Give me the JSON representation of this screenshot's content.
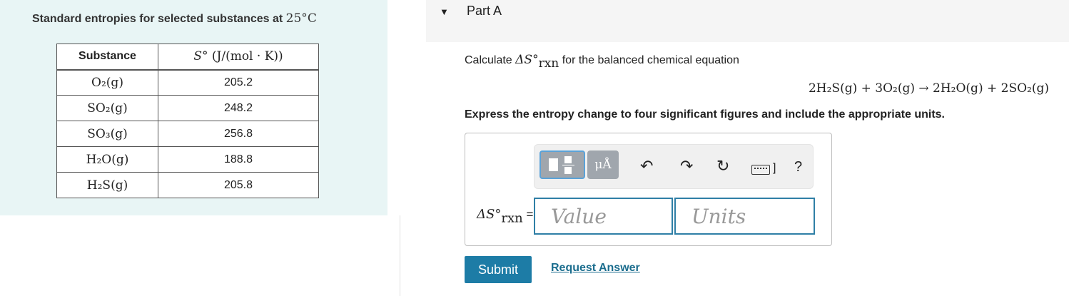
{
  "left_panel": {
    "title_text": "Standard entropies for selected substances at",
    "title_temp": "25°",
    "title_unit": "C",
    "table": {
      "header_substance": "Substance",
      "header_entropy_symbol": "S°",
      "header_entropy_unit": "(J/(mol · K))",
      "rows": [
        {
          "substance": "O₂(g)",
          "entropy": "205.2"
        },
        {
          "substance": "SO₂(g)",
          "entropy": "248.2"
        },
        {
          "substance": "SO₃(g)",
          "entropy": "256.8"
        },
        {
          "substance": "H₂O(g)",
          "entropy": "188.8"
        },
        {
          "substance": "H₂S(g)",
          "entropy": "205.8"
        }
      ]
    }
  },
  "part": {
    "toggle_icon": "▼",
    "title": "Part A"
  },
  "question": {
    "calc_prefix": "Calculate",
    "calc_symbol": "ΔS°",
    "calc_subscript": "rxn",
    "calc_suffix": "for the balanced chemical equation",
    "equation": "2H₂S(g) + 3O₂(g) → 2H₂O(g) + 2SO₂(g)",
    "instruction": "Express the entropy change to four significant figures and include the appropriate units."
  },
  "toolbar": {
    "units_label": "μÅ",
    "undo_icon": "↶",
    "redo_icon": "↷",
    "reset_icon": "↻",
    "keyboard_bracket": "]",
    "help_label": "?"
  },
  "answer": {
    "delta_symbol": "ΔS°",
    "delta_subscript": "rxn",
    "equals": "=",
    "value_placeholder": "Value",
    "units_placeholder": "Units"
  },
  "actions": {
    "submit_label": "Submit",
    "request_answer_label": "Request Answer"
  },
  "colors": {
    "left_panel_bg": "#e8f5f5",
    "submit_bg": "#1d7ca6",
    "link": "#1b6d8e",
    "input_border": "#2f7fa6"
  }
}
